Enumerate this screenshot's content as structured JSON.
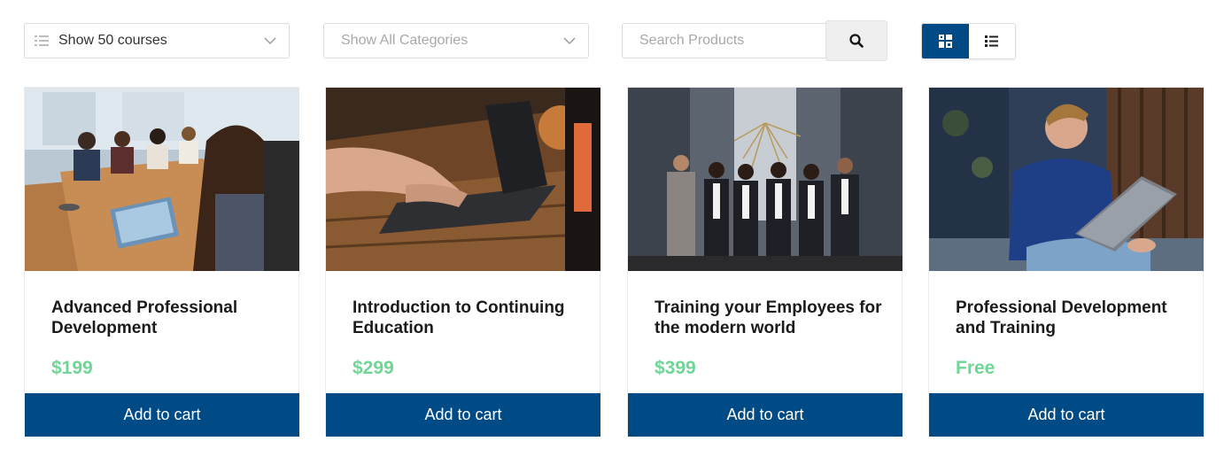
{
  "toolbar": {
    "show_select": {
      "value": "Show 50 courses"
    },
    "category_select": {
      "value": "Show All Categories"
    },
    "search": {
      "placeholder": "Search Products"
    }
  },
  "colors": {
    "accent": "#004a85",
    "price": "#6fd696"
  },
  "products": [
    {
      "title": "Advanced Professional Development",
      "price": "$199",
      "cart_label": "Add to cart",
      "image": "team-meeting-laptops"
    },
    {
      "title": "Introduction to Continuing Education",
      "price": "$299",
      "cart_label": "Add to cart",
      "image": "hands-typing-laptop"
    },
    {
      "title": "Training your Employees for the modern world",
      "price": "$399",
      "cart_label": "Add to cart",
      "image": "business-team-group-photo"
    },
    {
      "title": "Professional Development and Training",
      "price": "Free",
      "cart_label": "Add to cart",
      "image": "man-with-laptop"
    }
  ]
}
